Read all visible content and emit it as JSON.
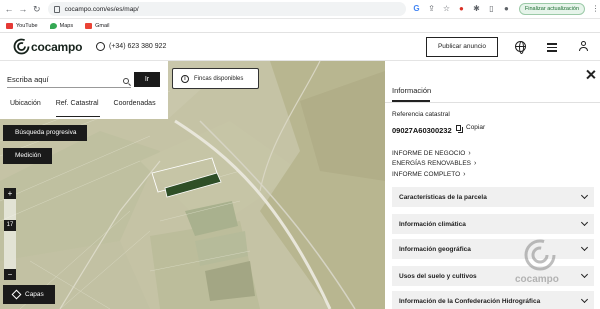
{
  "browser": {
    "url": "cocampo.com/es/es/map/",
    "update_label": "Finalizar actualización",
    "bookmarks": [
      {
        "label": "YouTube",
        "color": "#e53935"
      },
      {
        "label": "Maps",
        "color": "#34a853"
      },
      {
        "label": "Gmail",
        "color": "#ea4335"
      }
    ]
  },
  "header": {
    "logo_text": "cocampo",
    "phone": "(+34) 623 380 922",
    "publish_label": "Publicar anuncio"
  },
  "search": {
    "placeholder": "Escriba aquí",
    "go_label": "Ir",
    "tabs": [
      "Ubicación",
      "Ref. Catastral",
      "Coordenadas"
    ],
    "active_tab": "Ref. Catastral"
  },
  "map": {
    "fincas_label": "Fincas disponibles",
    "busqueda_label": "Búsqueda progresiva",
    "medicion_label": "Medición",
    "zoom_level": "17",
    "zoom_in": "+",
    "zoom_out": "−",
    "capas_label": "Capas"
  },
  "panel": {
    "tab_label": "Información",
    "ref_label": "Referencia catastral",
    "ref_value": "09027A60300232",
    "copy_label": "Copiar",
    "links": [
      "INFORME DE NEGOCIO",
      "ENERGÍAS RENOVABLES",
      "INFORME COMPLETO"
    ],
    "sections": [
      "Características de la parcela",
      "Información climática",
      "Información geográfica",
      "Usos del suelo y cultivos",
      "Información de la Confederación Hidrográfica"
    ],
    "watermark_text": "cocampo"
  },
  "colors": {
    "accent_dark": "#1a1a1a",
    "selected_parcel": "#2f4f27"
  }
}
